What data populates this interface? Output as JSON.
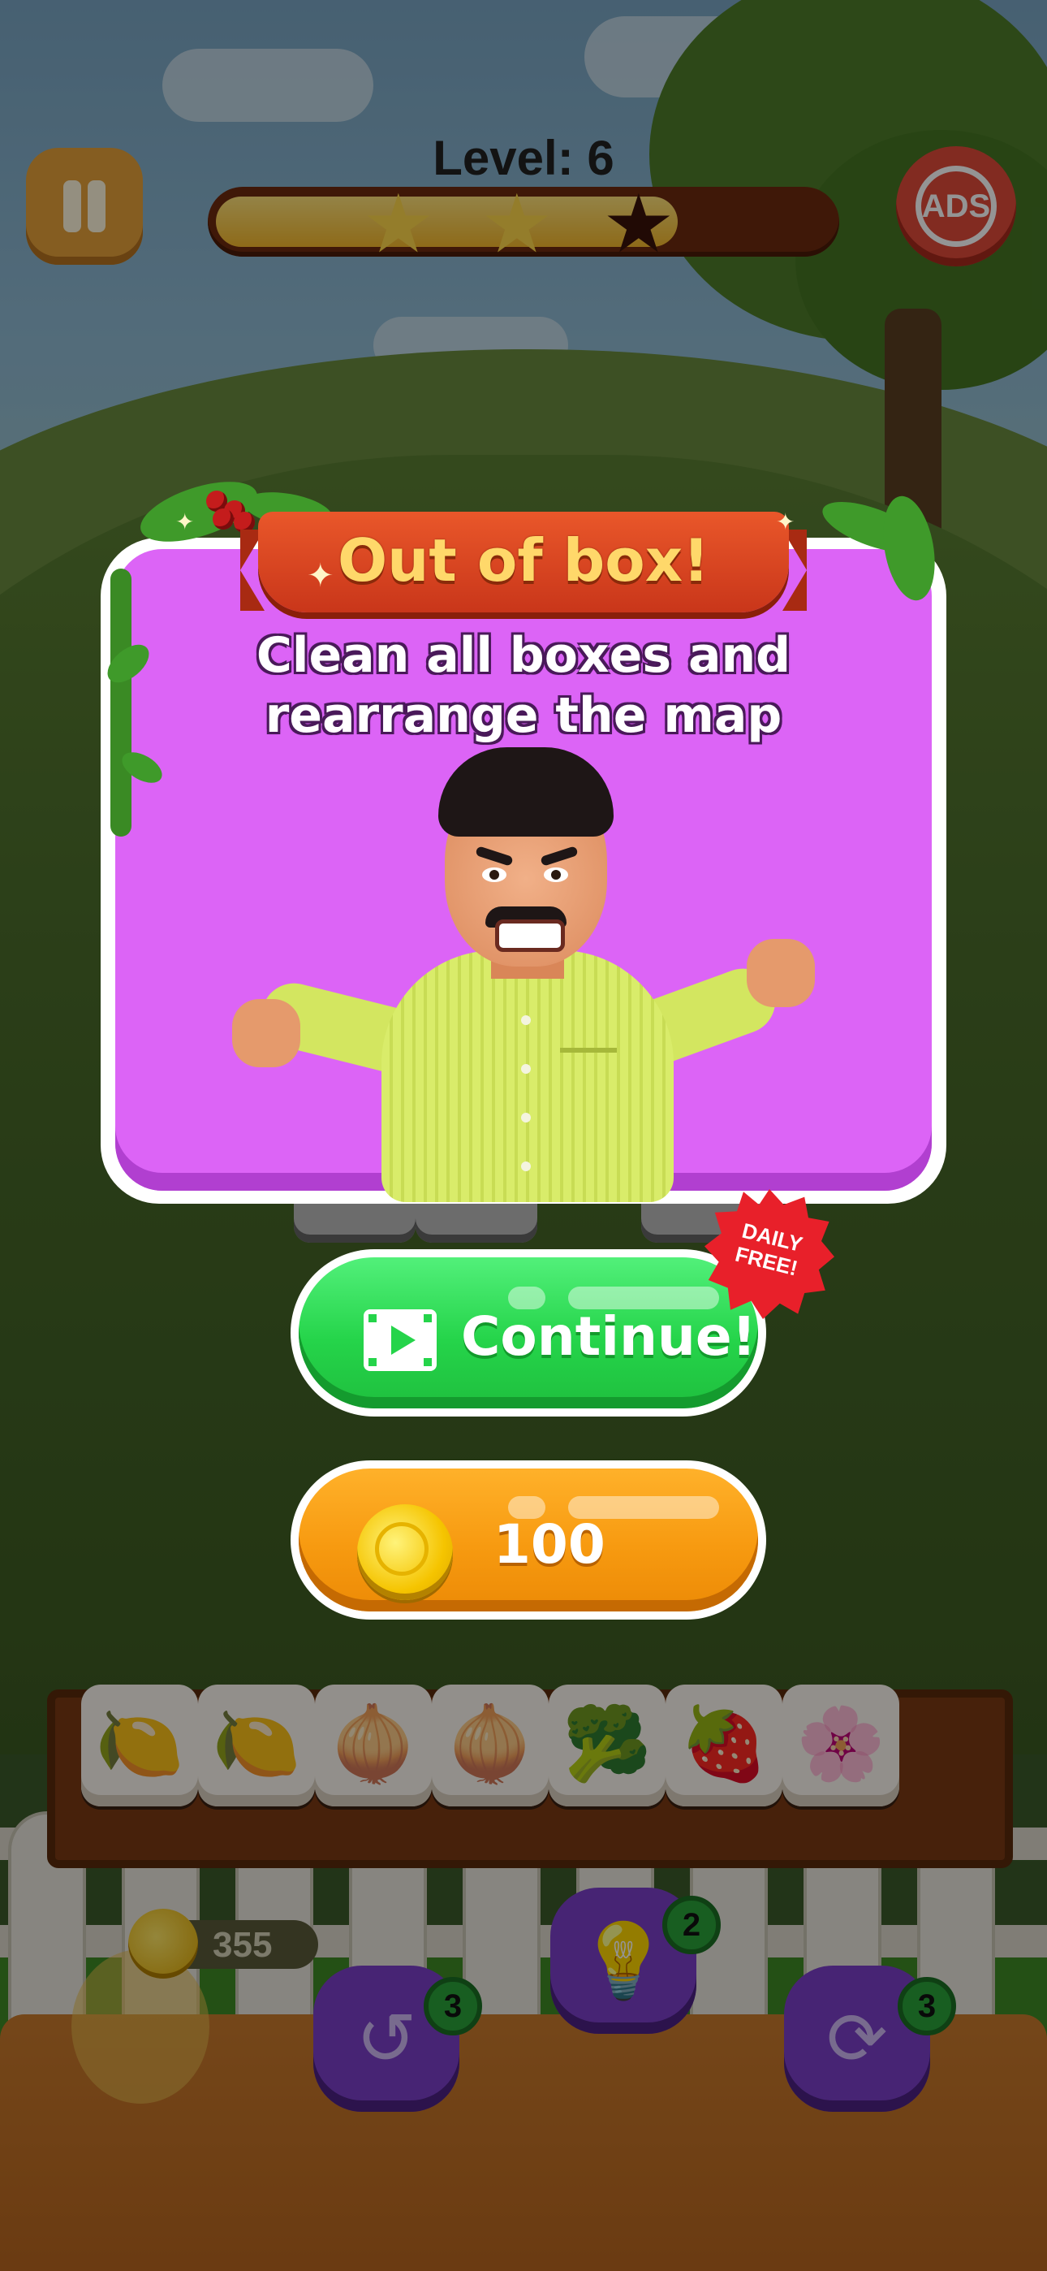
{
  "hud": {
    "level_text": "Level: 6",
    "progress": 0.75,
    "stars_earned": 2,
    "stars_total": 3,
    "ads_label": "ADS"
  },
  "modal": {
    "title": "Out of box!",
    "message_line1": "Clean all boxes and",
    "message_line2": "rearrange the map"
  },
  "continue_button": {
    "label": "Continue!",
    "badge_line1": "DAILY",
    "badge_line2": "FREE!"
  },
  "coin_button": {
    "label": "100"
  },
  "tray": {
    "tiles": [
      "lemon",
      "lemon",
      "onion",
      "onion",
      "broccoli",
      "strawberry",
      "blossom"
    ]
  },
  "bottom": {
    "coins": "355",
    "undo_count": "3",
    "hint_count": "2",
    "shuffle_count": "3"
  },
  "colors": {
    "modal_bg": "#dc64f6",
    "ribbon": "#d9431f",
    "continue_green": "#25d44a",
    "coin_orange": "#f79a10",
    "booster_purple": "#7a3ec8"
  }
}
